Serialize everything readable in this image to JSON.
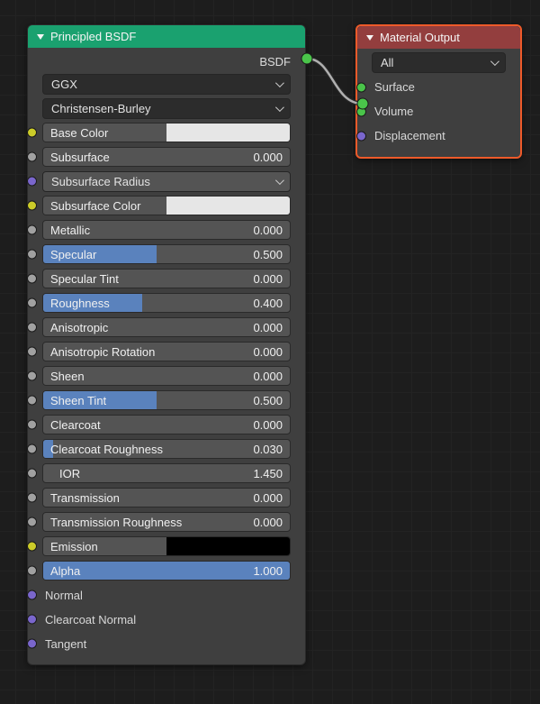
{
  "bsdf": {
    "title": "Principled BSDF",
    "output": "BSDF",
    "dist": "GGX",
    "sss": "Christensen-Burley",
    "base_color": {
      "label": "Base Color",
      "hex": "#e6e6e6"
    },
    "subsurface": {
      "label": "Subsurface",
      "value": "0.000",
      "fill": 0
    },
    "sss_radius": {
      "label": "Subsurface Radius"
    },
    "sss_color": {
      "label": "Subsurface Color",
      "hex": "#e6e6e6"
    },
    "metallic": {
      "label": "Metallic",
      "value": "0.000",
      "fill": 0
    },
    "specular": {
      "label": "Specular",
      "value": "0.500",
      "fill": 46
    },
    "spec_tint": {
      "label": "Specular Tint",
      "value": "0.000",
      "fill": 0
    },
    "roughness": {
      "label": "Roughness",
      "value": "0.400",
      "fill": 40
    },
    "anisotropic": {
      "label": "Anisotropic",
      "value": "0.000",
      "fill": 0
    },
    "aniso_rot": {
      "label": "Anisotropic Rotation",
      "value": "0.000",
      "fill": 0
    },
    "sheen": {
      "label": "Sheen",
      "value": "0.000",
      "fill": 0
    },
    "sheen_tint": {
      "label": "Sheen Tint",
      "value": "0.500",
      "fill": 46
    },
    "clearcoat": {
      "label": "Clearcoat",
      "value": "0.000",
      "fill": 0
    },
    "cc_rough": {
      "label": "Clearcoat Roughness",
      "value": "0.030",
      "fill": 4
    },
    "ior": {
      "label": "IOR",
      "value": "1.450",
      "fill": 0
    },
    "transmission": {
      "label": "Transmission",
      "value": "0.000",
      "fill": 0
    },
    "tr_rough": {
      "label": "Transmission Roughness",
      "value": "0.000",
      "fill": 0
    },
    "emission": {
      "label": "Emission",
      "hex": "#000000"
    },
    "alpha": {
      "label": "Alpha",
      "value": "1.000",
      "fill": 100
    },
    "normal": "Normal",
    "cc_normal": "Clearcoat Normal",
    "tangent": "Tangent"
  },
  "out": {
    "title": "Material Output",
    "target": "All",
    "surface": "Surface",
    "volume": "Volume",
    "displacement": "Displacement"
  }
}
